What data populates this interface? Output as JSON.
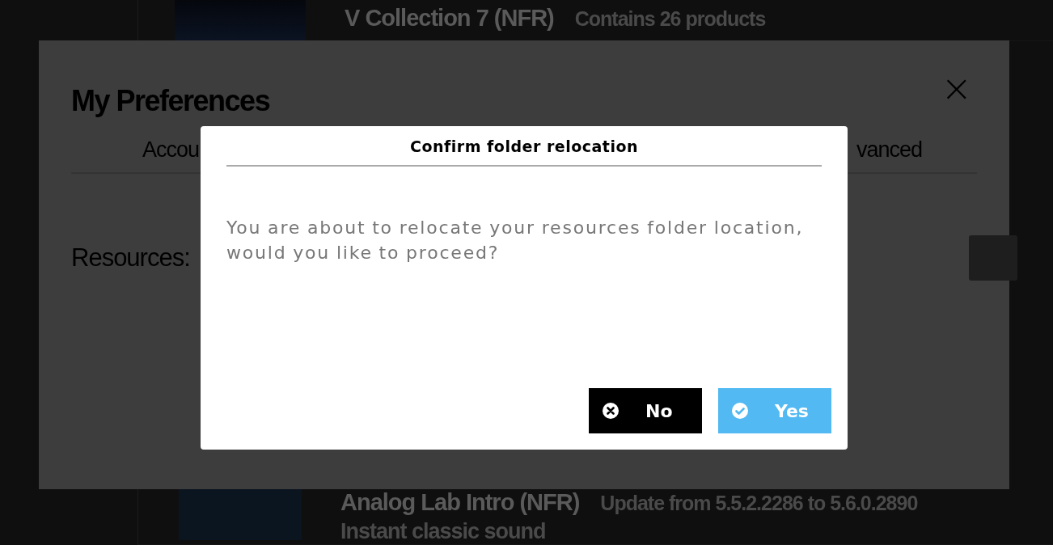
{
  "background_products": [
    {
      "title": "V Collection 7 (NFR)",
      "subtitle": "Contains 26 products"
    },
    {
      "title": "Analog Lab Intro (NFR)",
      "subtitle": "Update from 5.5.2.2286 to 5.6.0.2890",
      "description": "Instant classic sound"
    }
  ],
  "preferences": {
    "title": "My Preferences",
    "close": "×",
    "tabs": [
      {
        "label": "Accou"
      },
      {
        "label": "vanced"
      }
    ],
    "resources_label": "Resources:"
  },
  "dialog": {
    "title": "Confirm folder relocation",
    "message": "You are about to relocate your resources folder location, would you like to proceed?",
    "buttons": [
      {
        "kind": "cancel",
        "label": "No"
      },
      {
        "kind": "confirm",
        "label": "Yes"
      }
    ]
  }
}
